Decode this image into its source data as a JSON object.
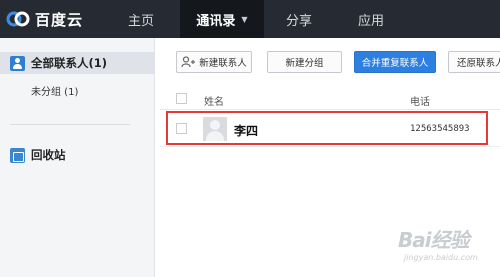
{
  "app": {
    "brand": "百度云"
  },
  "nav": [
    {
      "label": "主页"
    },
    {
      "label": "通讯录"
    },
    {
      "label": "分享"
    },
    {
      "label": "应用"
    }
  ],
  "sidebar": {
    "all_contacts": "全部联系人(1)",
    "ungrouped": "未分组 (1)",
    "recycle_bin": "回收站"
  },
  "toolbar": {
    "new_contact": "新建联系人",
    "new_group": "新建分组",
    "merge_duplicates": "合并重复联系人",
    "restore": "还原联系人"
  },
  "table": {
    "columns": {
      "name": "姓名",
      "phone": "电话"
    },
    "rows": [
      {
        "name": "李四",
        "phone": "12563545893"
      }
    ]
  },
  "watermark": {
    "brand": "Bai经验",
    "url": "jingyan.baidu.com"
  },
  "colors": {
    "topbar": "#262b33",
    "active_tab": "#14181d",
    "primary": "#2d7fe0",
    "highlight": "#e53935"
  }
}
